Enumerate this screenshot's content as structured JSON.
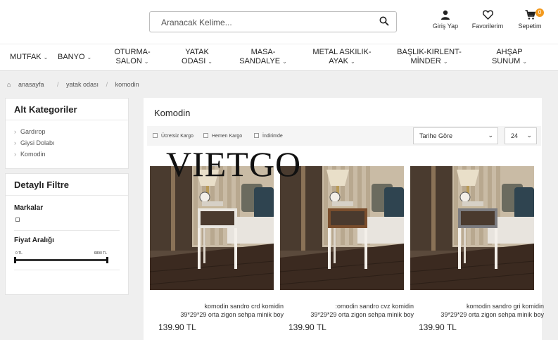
{
  "search": {
    "placeholder": "Aranacak Kelime..."
  },
  "header": {
    "login_label": "Giriş Yap",
    "favorites_label": "Favorilerim",
    "cart_label": "Sepetim",
    "cart_count": "0"
  },
  "nav": {
    "items": [
      {
        "line1": "MUTFAK",
        "line2": ""
      },
      {
        "line1": "BANYO",
        "line2": ""
      },
      {
        "line1": "OTURMA-",
        "line2": "SALON"
      },
      {
        "line1": "YATAK",
        "line2": "ODASI"
      },
      {
        "line1": "MASA-",
        "line2": "SANDALYE"
      },
      {
        "line1": "METAL ASKILIK-",
        "line2": "AYAK"
      },
      {
        "line1": "BAŞLIK-KIRLENT-",
        "line2": "MİNDER"
      },
      {
        "line1": "AHŞAP",
        "line2": "SUNUM"
      }
    ]
  },
  "breadcrumb": {
    "items": [
      "anasayfa",
      "yatak odası",
      "komodin"
    ]
  },
  "sidebar": {
    "categories_title": "Alt Kategoriler",
    "categories": [
      "Gardırop",
      "Giysi Dolabı",
      "Komodin"
    ],
    "filter_title": "Detaylı Filtre",
    "brands_label": "Markalar",
    "price_label": "Fiyat Aralığı",
    "price_min": "0 TL",
    "price_max": "6890 TL"
  },
  "main": {
    "title": "Komodin",
    "filters": [
      "Ücretsiz Kargo",
      "Hemen Kargo",
      "İndirimde"
    ],
    "sort_value": "Tarihe Göre",
    "page_size": "24"
  },
  "products": [
    {
      "name_line1": "komodin sandro crd komidin",
      "name_line2": "39*29*29 orta zigon sehpa minik boy",
      "price": "139.90 TL",
      "shelf_color": "#e9e6e0"
    },
    {
      "name_line1": ":omodin sandro cvz komidin",
      "name_line2": "39*29*29 orta zigon sehpa minik boy",
      "price": "139.90 TL",
      "shelf_color": "#7a4e2d"
    },
    {
      "name_line1": "komodin sandro gri komidin",
      "name_line2": "39*29*29 orta zigon sehpa minik boy",
      "price": "139.90 TL",
      "shelf_color": "#7c7c80"
    }
  ],
  "watermark": "VIETGO",
  "icons": {
    "search": "search-icon",
    "user": "user-icon",
    "heart": "heart-icon",
    "cart": "cart-icon",
    "home": "home-icon"
  }
}
